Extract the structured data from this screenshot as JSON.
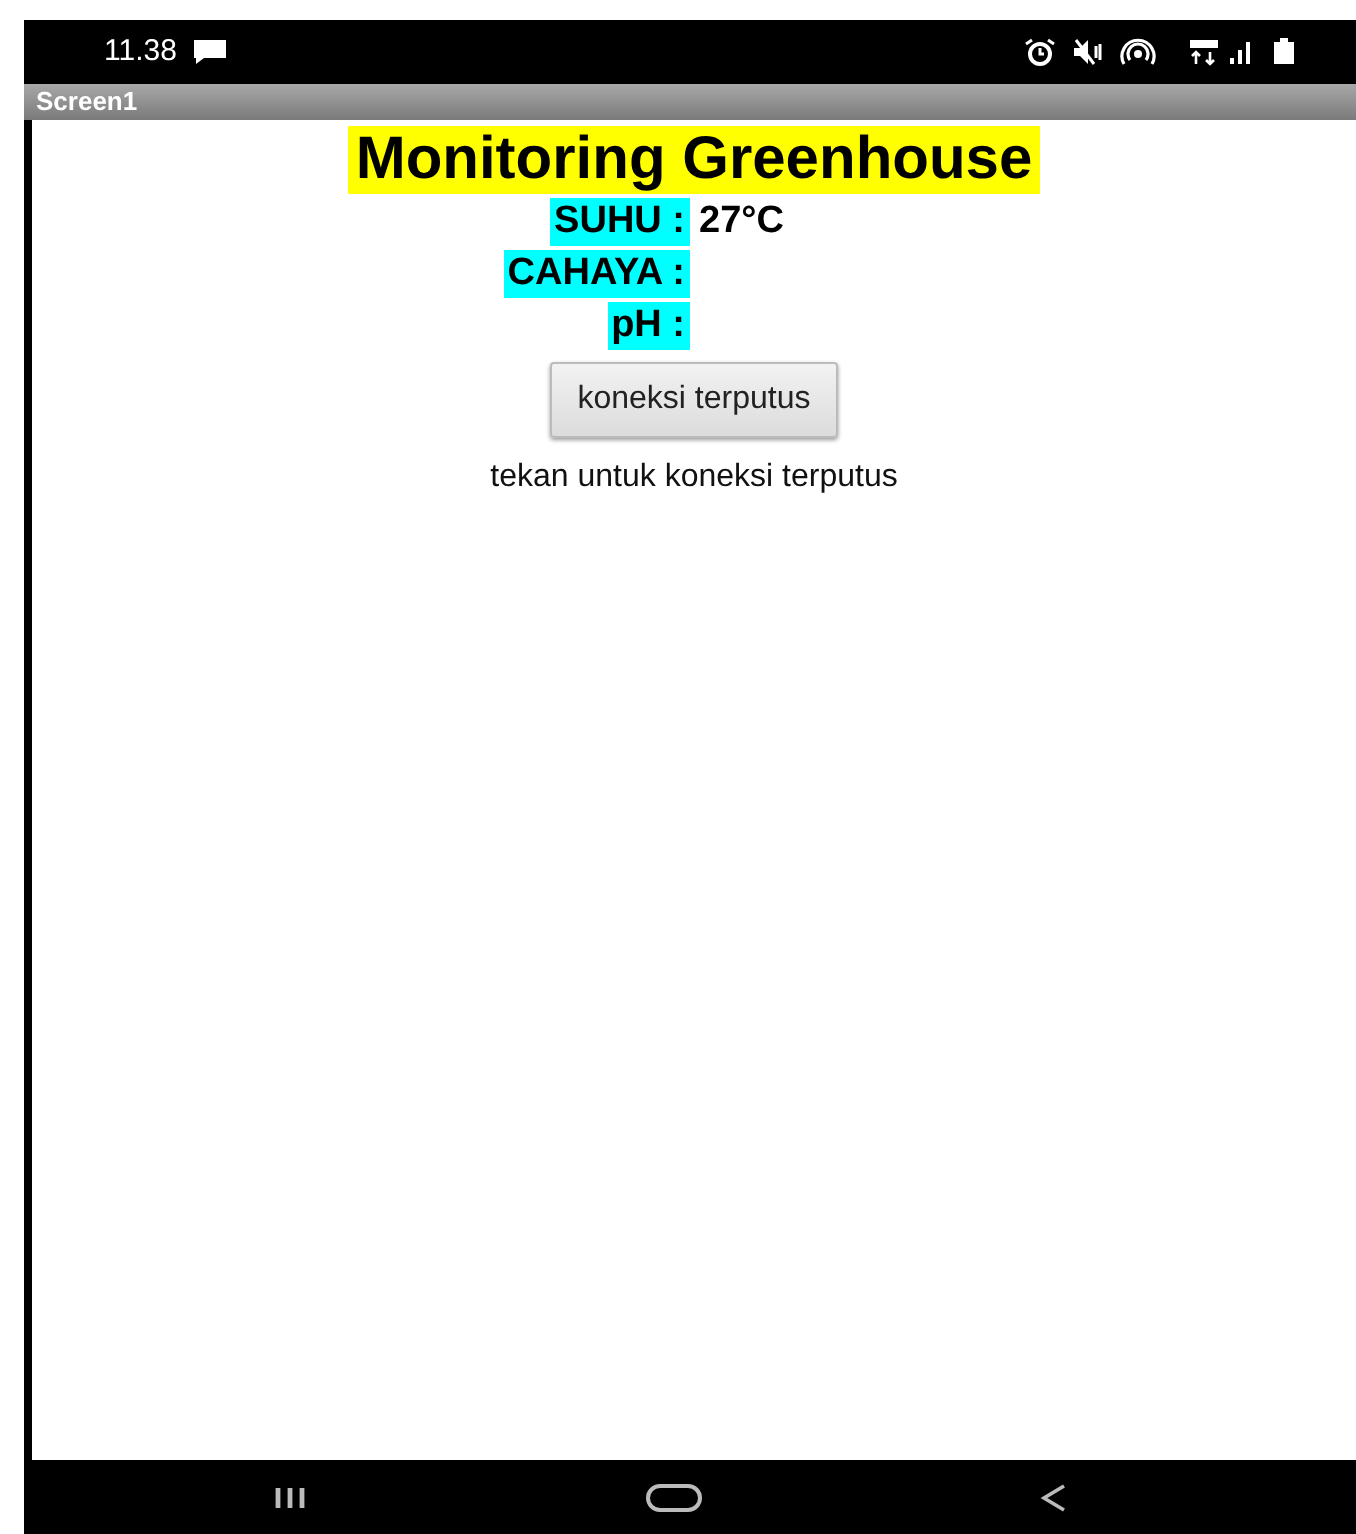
{
  "status_bar": {
    "time": "11.38"
  },
  "title_bar": {
    "title": "Screen1"
  },
  "heading": "Monitoring Greenhouse",
  "readings": [
    {
      "label": "SUHU :",
      "value": "27°C"
    },
    {
      "label": "CAHAYA :"
    },
    {
      "label": "pH :"
    }
  ],
  "button": {
    "label": "koneksi terputus"
  },
  "status_text": "tekan untuk koneksi terputus"
}
